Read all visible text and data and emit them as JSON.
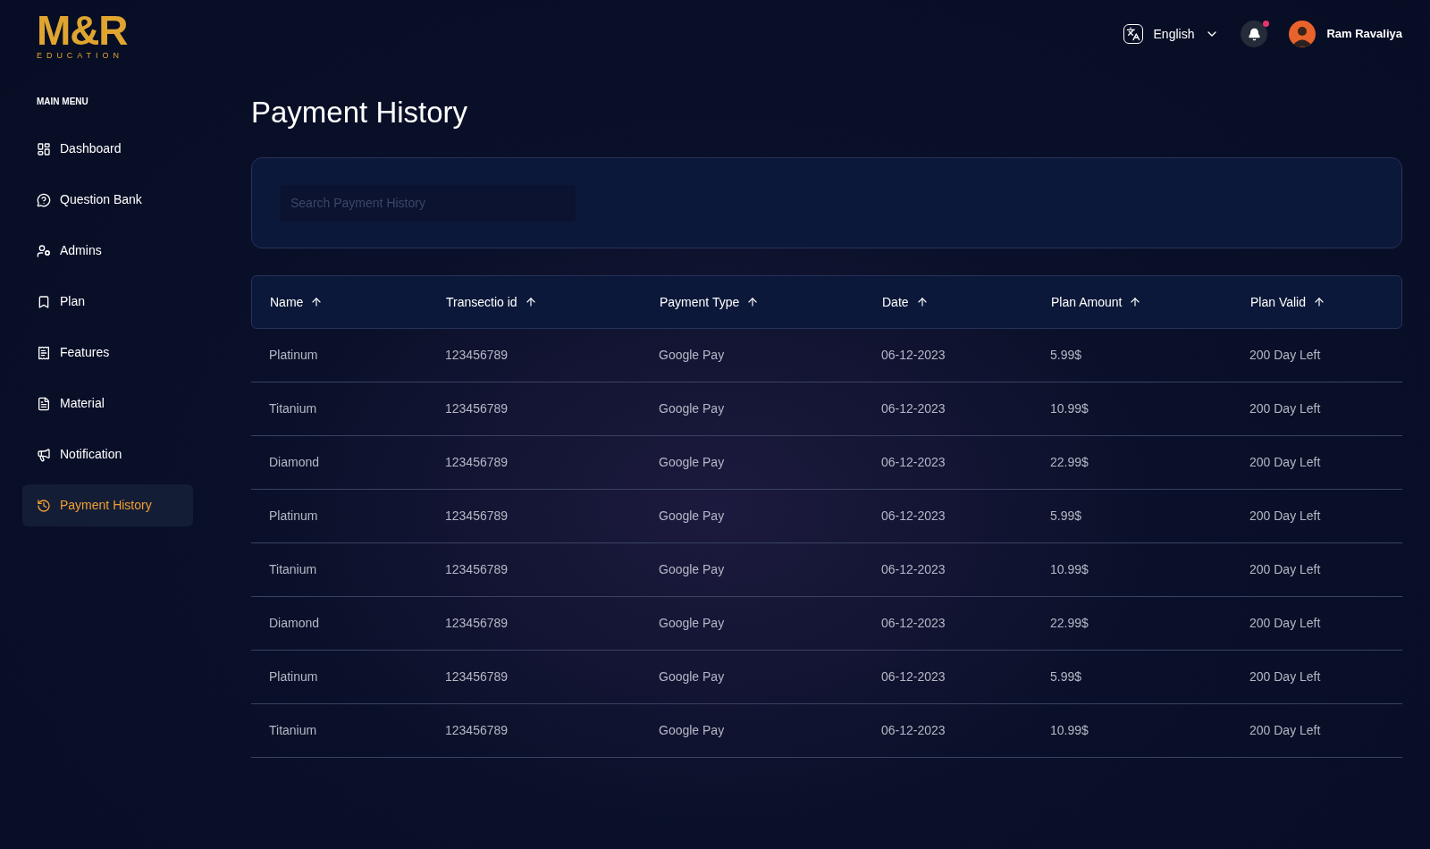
{
  "logo": {
    "mark": "M&R",
    "subtitle": "EDUCATION"
  },
  "sidebar": {
    "heading": "MAIN MENU",
    "items": [
      {
        "label": "Dashboard",
        "selected": false
      },
      {
        "label": "Question Bank",
        "selected": false
      },
      {
        "label": "Admins",
        "selected": false
      },
      {
        "label": "Plan",
        "selected": false
      },
      {
        "label": "Features",
        "selected": false
      },
      {
        "label": "Material",
        "selected": false
      },
      {
        "label": "Notification",
        "selected": false
      },
      {
        "label": "Payment History",
        "selected": true
      }
    ]
  },
  "topbar": {
    "language": "English",
    "notifications_unread": true,
    "user": "Ram Ravaliya"
  },
  "page_title": "Payment History",
  "search": {
    "placeholder": "Search Payment History"
  },
  "table": {
    "columns": [
      "Name",
      "Transectio id",
      "Payment Type",
      "Date",
      "Plan Amount",
      "Plan Valid"
    ],
    "rows": [
      [
        "Platinum",
        "123456789",
        "Google Pay",
        "06-12-2023",
        "5.99$",
        "200 Day Left"
      ],
      [
        "Titanium",
        "123456789",
        "Google Pay",
        "06-12-2023",
        "10.99$",
        "200 Day Left"
      ],
      [
        "Diamond",
        "123456789",
        "Google Pay",
        "06-12-2023",
        "22.99$",
        "200 Day Left"
      ],
      [
        "Platinum",
        "123456789",
        "Google Pay",
        "06-12-2023",
        "5.99$",
        "200 Day Left"
      ],
      [
        "Titanium",
        "123456789",
        "Google Pay",
        "06-12-2023",
        "10.99$",
        "200 Day Left"
      ],
      [
        "Diamond",
        "123456789",
        "Google Pay",
        "06-12-2023",
        "22.99$",
        "200 Day Left"
      ],
      [
        "Platinum",
        "123456789",
        "Google Pay",
        "06-12-2023",
        "5.99$",
        "200 Day Left"
      ],
      [
        "Titanium",
        "123456789",
        "Google Pay",
        "06-12-2023",
        "10.99$",
        "200 Day Left"
      ]
    ]
  }
}
